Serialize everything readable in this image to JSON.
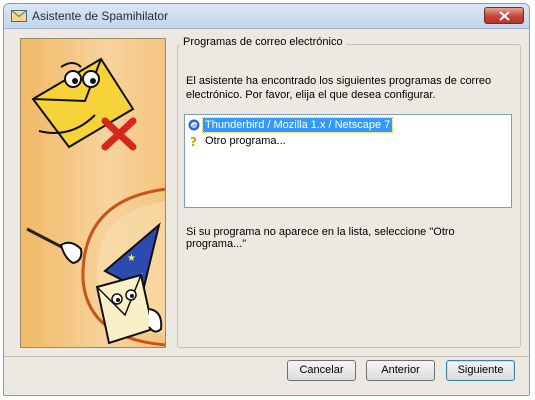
{
  "window": {
    "title": "Asistente de Spamihilator"
  },
  "colors": {
    "selection": "#3399ff",
    "close_button": "#c4443a",
    "panel_orange": "#f4c57f"
  },
  "group": {
    "title": "Programas de correo electrónico",
    "description": "El asistente ha encontrado los siguientes programas de correo electrónico. Por favor, elija el que desea configurar.",
    "hint": "Si su programa no aparece en la lista, seleccione \"Otro programa...\""
  },
  "list": {
    "items": [
      {
        "label": "Thunderbird / Mozilla 1.x / Netscape 7",
        "icon": "thunderbird-icon",
        "selected": true
      },
      {
        "label": "Otro programa...",
        "icon": "question-mark-icon",
        "selected": false
      }
    ]
  },
  "buttons": {
    "cancel": "Cancelar",
    "back": "Anterior",
    "next": "Siguiente"
  }
}
